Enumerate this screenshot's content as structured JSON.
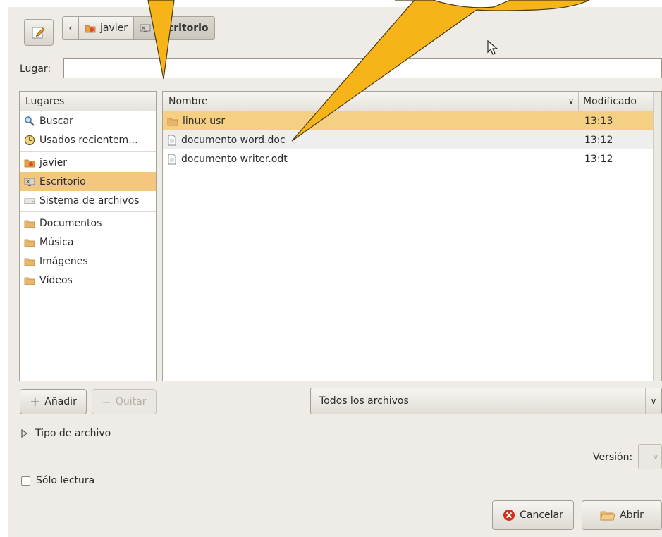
{
  "toolbar": {
    "breadcrumbs": [
      {
        "label": "javier"
      },
      {
        "label": "Escritorio"
      }
    ]
  },
  "location": {
    "label": "Lugar:",
    "value": ""
  },
  "places": {
    "header": "Lugares",
    "items": [
      {
        "label": "Buscar",
        "icon": "search-icon"
      },
      {
        "label": "Usados recientem...",
        "icon": "recent-icon"
      },
      {
        "label": "javier",
        "icon": "home-folder-icon"
      },
      {
        "label": "Escritorio",
        "icon": "desktop-icon",
        "selected": true
      },
      {
        "label": "Sistema de archivos",
        "icon": "drive-icon"
      },
      {
        "label": "Documentos",
        "icon": "folder-icon"
      },
      {
        "label": "Música",
        "icon": "folder-icon"
      },
      {
        "label": "Imágenes",
        "icon": "folder-icon"
      },
      {
        "label": "Vídeos",
        "icon": "folder-icon"
      }
    ]
  },
  "files": {
    "name_header": "Nombre",
    "modified_header": "Modificado",
    "rows": [
      {
        "name": "linux usr",
        "modified": "13:13",
        "icon": "folder-icon",
        "selected": true
      },
      {
        "name": "documento word.doc",
        "modified": "13:12",
        "icon": "document-icon"
      },
      {
        "name": "documento writer.odt",
        "modified": "13:12",
        "icon": "document-icon"
      }
    ]
  },
  "buttons": {
    "add": "Añadir",
    "remove": "Quitar",
    "cancel": "Cancelar",
    "open": "Abrir"
  },
  "filter": {
    "selected": "Todos los archivos"
  },
  "file_type": {
    "label": "Tipo de archivo"
  },
  "version": {
    "label": "Versión:"
  },
  "readonly": {
    "label": "Sólo lectura",
    "checked": false
  },
  "colors": {
    "callout_fill": "#f7b418",
    "selection": "#f3c77e"
  }
}
